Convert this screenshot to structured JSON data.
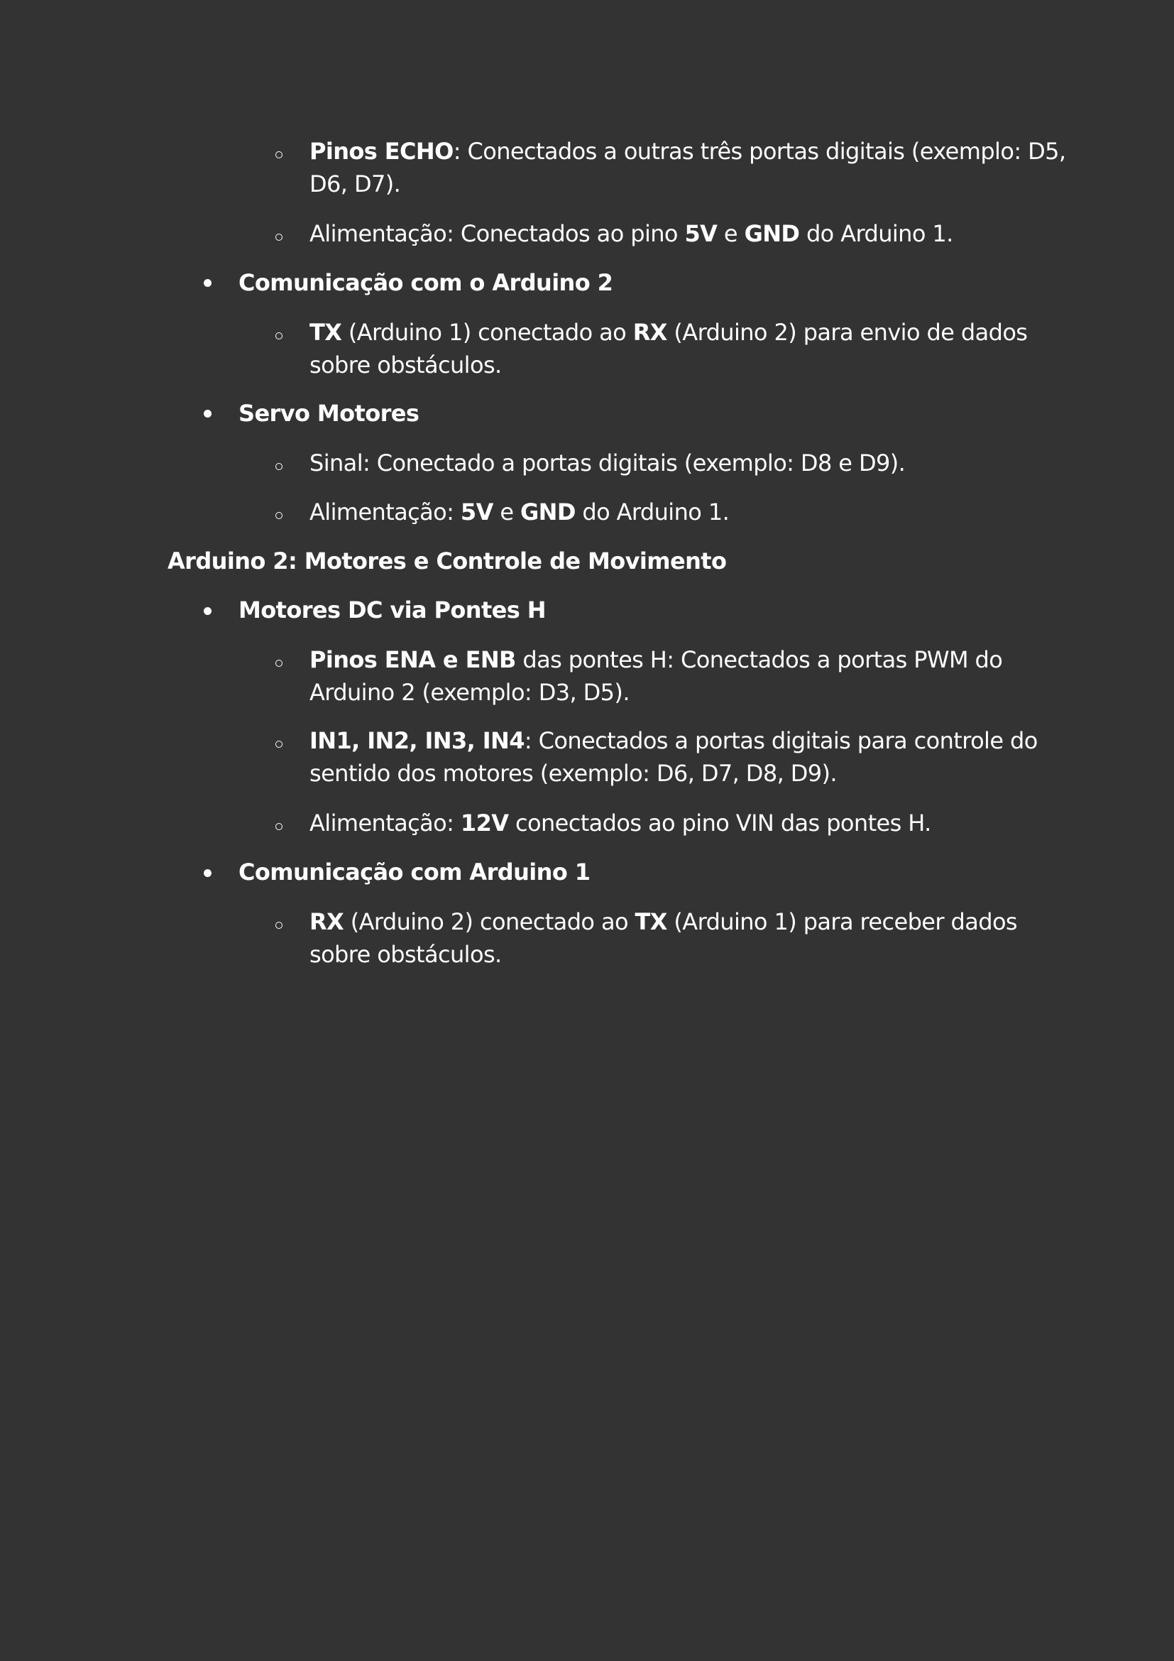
{
  "doc": {
    "item_echo": {
      "label": "Pinos ECHO",
      "text_a": ": Conectados a outras três portas digitais (exemplo: D5,",
      "text_b": "D6, D7)."
    },
    "item_power1": {
      "t1": "Alimentação: Conectados ao pino ",
      "b1": "5V",
      "t2": " e ",
      "b2": "GND",
      "t3": " do Arduino 1."
    },
    "comm2": {
      "heading": "Comunicação com o Arduino 2",
      "b1": "TX",
      "t1": " (Arduino 1) conectado ao ",
      "b2": "RX",
      "t2": " (Arduino 2) para envio de dados",
      "t3": "sobre obstáculos."
    },
    "servo": {
      "heading": "Servo Motores",
      "signal": "Sinal: Conectado a portas digitais (exemplo: D8 e D9).",
      "p_t1": "Alimentação: ",
      "p_b1": "5V",
      "p_t2": " e ",
      "p_b2": "GND",
      "p_t3": " do Arduino 1."
    },
    "section2_title": "Arduino 2: Motores e Controle de Movimento",
    "dc": {
      "heading": "Motores DC via Pontes H",
      "ena_label": "Pinos ENA e ENB",
      "ena_a": " das pontes H: Conectados a portas PWM do",
      "ena_b": "Arduino 2 (exemplo: D3, D5).",
      "in_label": "IN1, IN2, IN3, IN4",
      "in_a": ": Conectados a portas digitais para controle do",
      "in_b": "sentido dos motores (exemplo: D6, D7, D8, D9).",
      "pw_t1": "Alimentação: ",
      "pw_b1": "12V",
      "pw_t2": " conectados ao pino VIN das pontes H."
    },
    "comm1": {
      "heading": "Comunicação com Arduino 1",
      "b1": "RX",
      "t1": " (Arduino 2) conectado ao ",
      "b2": "TX",
      "t2": " (Arduino 1) para receber dados",
      "t3": "sobre obstáculos."
    }
  }
}
